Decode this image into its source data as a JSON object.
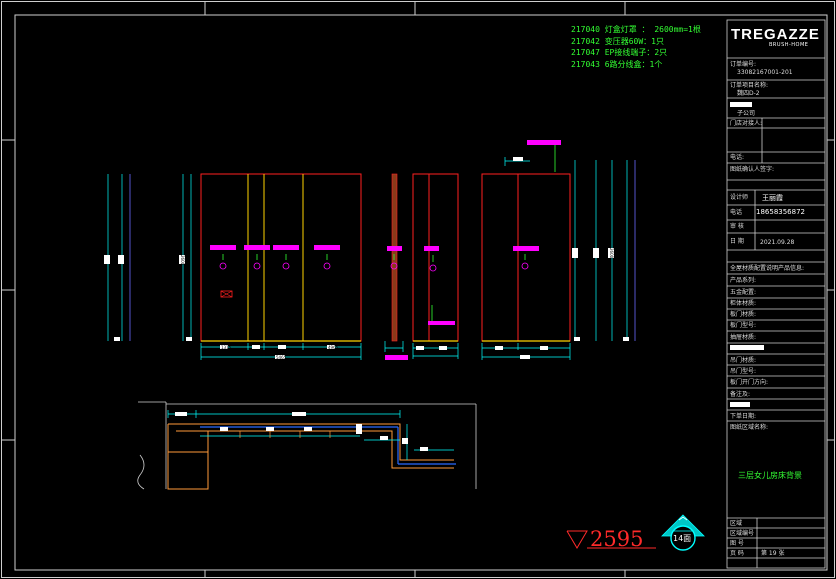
{
  "notes": [
    "217040 灯盒灯罩 ： 2600mm=1根",
    "217042 变压器60W：1只",
    "217047 EP接线端子：2只",
    "217043 6路分线盒：1个"
  ],
  "brand": {
    "name": "TREGAZZE",
    "sub": "BRUSH-HOME"
  },
  "title_block": {
    "order_no_label": "订单编号:",
    "order_no": "33082167001-201",
    "project_label": "订单项目名称:",
    "project": "魏四D-2",
    "company": "子公司",
    "contact_label": "门店对接人:",
    "phone_label": "电话:",
    "confirm_label": "图纸确认人签字:",
    "designer_label": "设计师",
    "designer": "王丽霞",
    "tel_label": "电话",
    "tel": "18658356872",
    "review_label": "审 核",
    "date_label": "日 期",
    "date": "2021.09.28",
    "info_label": "全屋材质配置说明产品信息:",
    "rows": [
      "产品系列:",
      "五金配置:",
      "柜体材质:",
      "板门材质:",
      "板门型号:",
      "抽屉材质:",
      "",
      "吊门材质:",
      "吊门型号:",
      "板门开门方向:",
      "备注及:",
      "",
      "下单日期:"
    ],
    "area_label": "图纸区域名称:",
    "area_name": "三层女儿房床背景",
    "bottom_rows": [
      "区域",
      "区域编号",
      "图 号",
      "页 码"
    ],
    "page": "第 19 张"
  },
  "level_mark": "2595",
  "section_mark": "14面",
  "dims": {
    "front": [
      "1315",
      "2600",
      "5465",
      "4965"
    ],
    "side": [
      "2600"
    ]
  }
}
